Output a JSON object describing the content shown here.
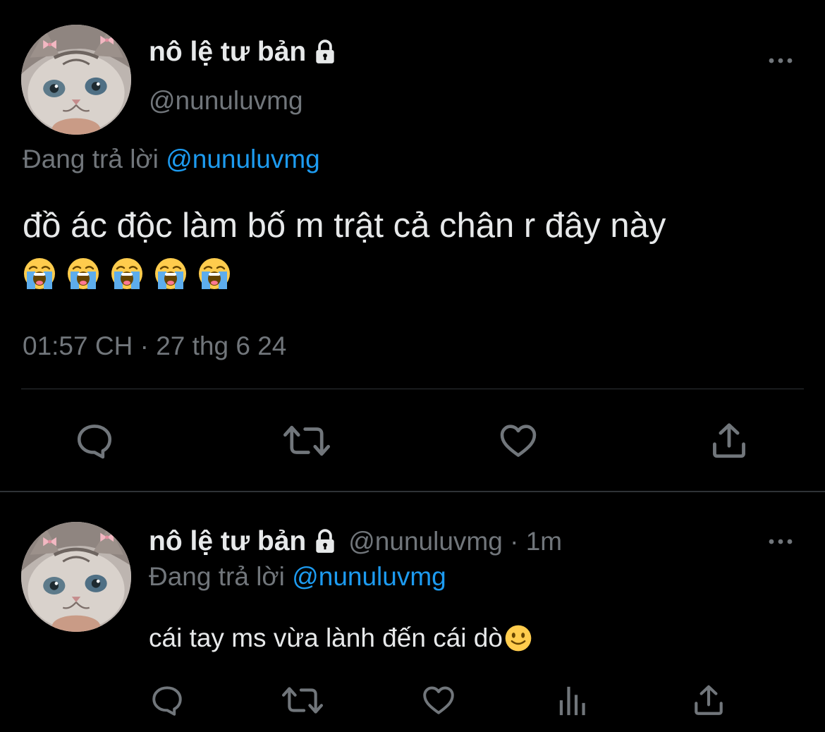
{
  "main_tweet": {
    "display_name": "nô lệ tư bản",
    "handle": "@nunuluvmg",
    "replying_prefix": "Đang trả lời",
    "replying_to": "@nunuluvmg",
    "text": "đồ ác độc làm bố m trật cả chân r đây này",
    "emojis": [
      "loudly-crying-face",
      "loudly-crying-face",
      "loudly-crying-face",
      "loudly-crying-face",
      "loudly-crying-face"
    ],
    "timestamp": "01:57 CH · 27 thg 6 24",
    "icons": [
      "reply-icon",
      "retweet-icon",
      "like-icon",
      "share-icon",
      "more-icon",
      "lock-icon"
    ]
  },
  "reply_tweet": {
    "display_name": "nô lệ tư bản",
    "handle_time": "@nunuluvmg · 1m",
    "replying_prefix": "Đang trả lời",
    "replying_to": "@nunuluvmg",
    "text": "cái tay ms vừa lành đến cái dò",
    "emoji": "slightly-smiling-face",
    "icons": [
      "reply-icon",
      "retweet-icon",
      "like-icon",
      "views-icon",
      "share-icon",
      "more-icon",
      "lock-icon"
    ]
  },
  "colors": {
    "background": "#000000",
    "primary_text": "#e7e9ea",
    "secondary_text": "#71767b",
    "link": "#1d9bf0",
    "divider": "#2f3336"
  }
}
